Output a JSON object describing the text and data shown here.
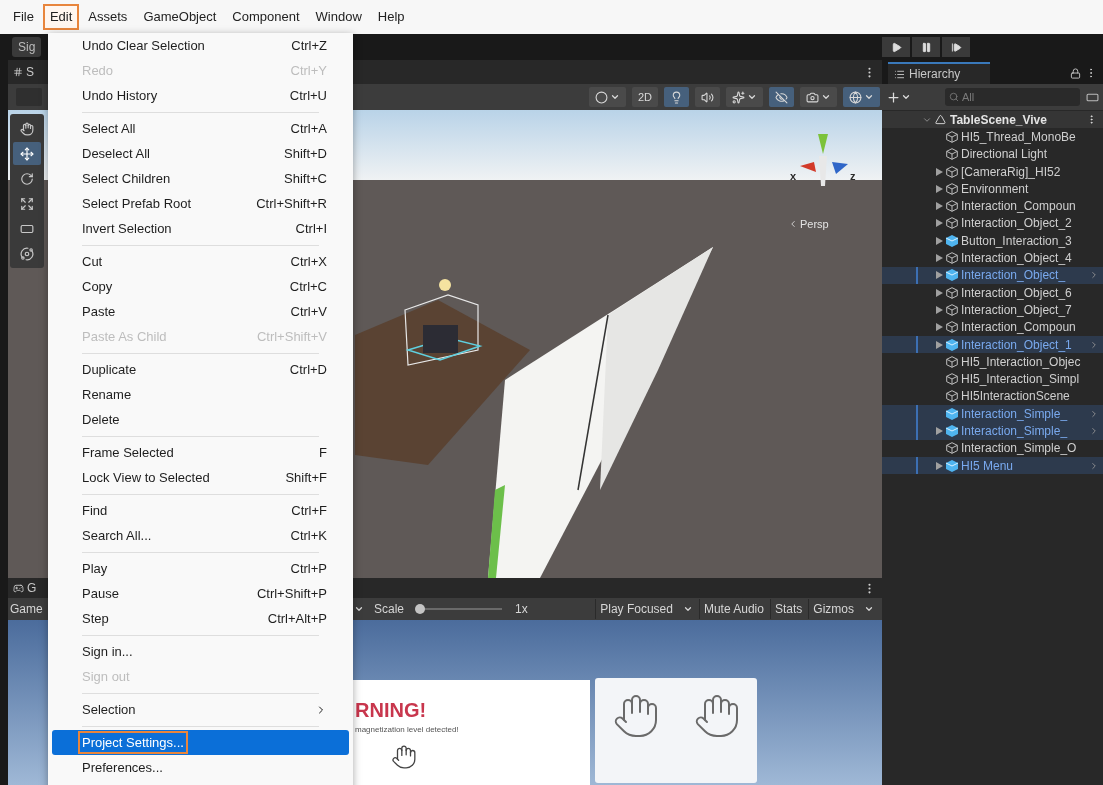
{
  "menu_bar": [
    {
      "label": "File",
      "selected": false
    },
    {
      "label": "Edit",
      "selected": true
    },
    {
      "label": "Assets",
      "selected": false
    },
    {
      "label": "GameObject",
      "selected": false
    },
    {
      "label": "Component",
      "selected": false
    },
    {
      "label": "Window",
      "selected": false
    },
    {
      "label": "Help",
      "selected": false
    }
  ],
  "edit_menu": [
    {
      "kind": "item",
      "label": "Undo Clear Selection",
      "shortcut": "Ctrl+Z",
      "disabled": false,
      "selected": false,
      "outlined": false
    },
    {
      "kind": "item",
      "label": "Redo",
      "shortcut": "Ctrl+Y",
      "disabled": true,
      "selected": false,
      "outlined": false
    },
    {
      "kind": "item",
      "label": "Undo History",
      "shortcut": "Ctrl+U",
      "disabled": false,
      "selected": false,
      "outlined": false
    },
    {
      "kind": "separator"
    },
    {
      "kind": "item",
      "label": "Select All",
      "shortcut": "Ctrl+A",
      "disabled": false,
      "selected": false,
      "outlined": false
    },
    {
      "kind": "item",
      "label": "Deselect All",
      "shortcut": "Shift+D",
      "disabled": false,
      "selected": false,
      "outlined": false
    },
    {
      "kind": "item",
      "label": "Select Children",
      "shortcut": "Shift+C",
      "disabled": false,
      "selected": false,
      "outlined": false
    },
    {
      "kind": "item",
      "label": "Select Prefab Root",
      "shortcut": "Ctrl+Shift+R",
      "disabled": false,
      "selected": false,
      "outlined": false
    },
    {
      "kind": "item",
      "label": "Invert Selection",
      "shortcut": "Ctrl+I",
      "disabled": false,
      "selected": false,
      "outlined": false
    },
    {
      "kind": "separator"
    },
    {
      "kind": "item",
      "label": "Cut",
      "shortcut": "Ctrl+X",
      "disabled": false,
      "selected": false,
      "outlined": false
    },
    {
      "kind": "item",
      "label": "Copy",
      "shortcut": "Ctrl+C",
      "disabled": false,
      "selected": false,
      "outlined": false
    },
    {
      "kind": "item",
      "label": "Paste",
      "shortcut": "Ctrl+V",
      "disabled": false,
      "selected": false,
      "outlined": false
    },
    {
      "kind": "item",
      "label": "Paste As Child",
      "shortcut": "Ctrl+Shift+V",
      "disabled": true,
      "selected": false,
      "outlined": false
    },
    {
      "kind": "separator"
    },
    {
      "kind": "item",
      "label": "Duplicate",
      "shortcut": "Ctrl+D",
      "disabled": false,
      "selected": false,
      "outlined": false
    },
    {
      "kind": "item",
      "label": "Rename",
      "disabled": false,
      "selected": false,
      "outlined": false
    },
    {
      "kind": "item",
      "label": "Delete",
      "disabled": false,
      "selected": false,
      "outlined": false
    },
    {
      "kind": "separator"
    },
    {
      "kind": "item",
      "label": "Frame Selected",
      "shortcut": "F",
      "disabled": false,
      "selected": false,
      "outlined": false
    },
    {
      "kind": "item",
      "label": "Lock View to Selected",
      "shortcut": "Shift+F",
      "disabled": false,
      "selected": false,
      "outlined": false
    },
    {
      "kind": "separator"
    },
    {
      "kind": "item",
      "label": "Find",
      "shortcut": "Ctrl+F",
      "disabled": false,
      "selected": false,
      "outlined": false
    },
    {
      "kind": "item",
      "label": "Search All...",
      "shortcut": "Ctrl+K",
      "disabled": false,
      "selected": false,
      "outlined": false
    },
    {
      "kind": "separator"
    },
    {
      "kind": "item",
      "label": "Play",
      "shortcut": "Ctrl+P",
      "disabled": false,
      "selected": false,
      "outlined": false
    },
    {
      "kind": "item",
      "label": "Pause",
      "shortcut": "Ctrl+Shift+P",
      "disabled": false,
      "selected": false,
      "outlined": false
    },
    {
      "kind": "item",
      "label": "Step",
      "shortcut": "Ctrl+Alt+P",
      "disabled": false,
      "selected": false,
      "outlined": false
    },
    {
      "kind": "separator"
    },
    {
      "kind": "item",
      "label": "Sign in...",
      "disabled": false,
      "selected": false,
      "outlined": false
    },
    {
      "kind": "item",
      "label": "Sign out",
      "disabled": true,
      "selected": false,
      "outlined": false
    },
    {
      "kind": "separator"
    },
    {
      "kind": "submenu",
      "label": "Selection",
      "disabled": false,
      "selected": false,
      "outlined": false
    },
    {
      "kind": "separator"
    },
    {
      "kind": "item",
      "label": "Project Settings...",
      "disabled": false,
      "selected": true,
      "outlined": true
    },
    {
      "kind": "item",
      "label": "Preferences...",
      "disabled": false,
      "selected": false,
      "outlined": false
    }
  ],
  "toolbar": {
    "account_button": "Sig"
  },
  "scene": {
    "tab": "S",
    "tools": [
      {
        "kind": "hand",
        "selected": false
      },
      {
        "kind": "move",
        "selected": true
      },
      {
        "kind": "rotate",
        "selected": false
      },
      {
        "kind": "scale",
        "selected": false
      },
      {
        "kind": "rect",
        "selected": false
      },
      {
        "kind": "transform",
        "selected": false
      }
    ],
    "view_buttons": [
      {
        "kind": "shading",
        "on": false,
        "dropdown": true
      },
      {
        "kind": "dimension",
        "label": "2D",
        "on": false,
        "dropdown": false
      },
      {
        "kind": "lighting",
        "on": true,
        "dropdown": false
      },
      {
        "kind": "audio",
        "on": false,
        "dropdown": false
      },
      {
        "kind": "effects",
        "on": false,
        "dropdown": true
      },
      {
        "kind": "visibility",
        "on": true,
        "dropdown": false
      },
      {
        "kind": "camera",
        "on": false,
        "dropdown": true
      },
      {
        "kind": "gizmos",
        "on": true,
        "dropdown": true
      }
    ],
    "axis_labels": [
      "x",
      "z"
    ],
    "projection": "Persp"
  },
  "game": {
    "tab": "G",
    "display": "Game",
    "scale_label": "Scale",
    "scale": {
      "level": 0.04
    },
    "scale_value": "1x",
    "buttons": [
      {
        "label": "Play Focused",
        "dropdown": true
      },
      {
        "label": "Mute Audio",
        "dropdown": false
      },
      {
        "label": "Stats",
        "dropdown": false
      },
      {
        "label": "Gizmos",
        "dropdown": true
      }
    ],
    "warning_title": "RNING!",
    "warning_text": "magnetization level detected!"
  },
  "hierarchy": {
    "title": "Hierarchy",
    "search": {
      "placeholder": "All"
    },
    "root": {
      "label": "TableScene_Vive",
      "expanded": true,
      "children": [
        {
          "label": "HI5_Thread_MonoBe",
          "kind": "object",
          "expandable": false,
          "selected": false
        },
        {
          "label": "Directional Light",
          "kind": "object",
          "expandable": false,
          "selected": false
        },
        {
          "label": "[CameraRig]_HI52",
          "kind": "object",
          "expandable": true,
          "selected": false
        },
        {
          "label": "Environment",
          "kind": "object",
          "expandable": true,
          "selected": false
        },
        {
          "label": "Interaction_Compoun",
          "kind": "object",
          "expandable": true,
          "selected": false
        },
        {
          "label": "Interaction_Object_2",
          "kind": "object",
          "expandable": true,
          "selected": false
        },
        {
          "label": "Button_Interaction_3",
          "kind": "prefab",
          "expandable": true,
          "selected": false
        },
        {
          "label": "Interaction_Object_4",
          "kind": "object",
          "expandable": true,
          "selected": false
        },
        {
          "label": "Interaction_Object_",
          "kind": "prefab",
          "expandable": true,
          "selected": true
        },
        {
          "label": "Interaction_Object_6",
          "kind": "object",
          "expandable": true,
          "selected": false
        },
        {
          "label": "Interaction_Object_7",
          "kind": "object",
          "expandable": true,
          "selected": false
        },
        {
          "label": "Interaction_Compoun",
          "kind": "object",
          "expandable": true,
          "selected": false
        },
        {
          "label": "Interaction_Object_1",
          "kind": "prefab",
          "expandable": true,
          "selected": true
        },
        {
          "label": "HI5_Interaction_Objec",
          "kind": "object",
          "expandable": false,
          "selected": false
        },
        {
          "label": "HI5_Interaction_Simpl",
          "kind": "object",
          "expandable": false,
          "selected": false
        },
        {
          "label": "HI5InteractionScene",
          "kind": "object",
          "expandable": false,
          "selected": false
        },
        {
          "label": "Interaction_Simple_",
          "kind": "prefab",
          "expandable": false,
          "selected": true
        },
        {
          "label": "Interaction_Simple_",
          "kind": "prefab",
          "expandable": true,
          "selected": true
        },
        {
          "label": "Interaction_Simple_O",
          "kind": "object",
          "expandable": false,
          "selected": false
        },
        {
          "label": "HI5 Menu",
          "kind": "prefab",
          "expandable": true,
          "selected": true
        }
      ]
    }
  }
}
